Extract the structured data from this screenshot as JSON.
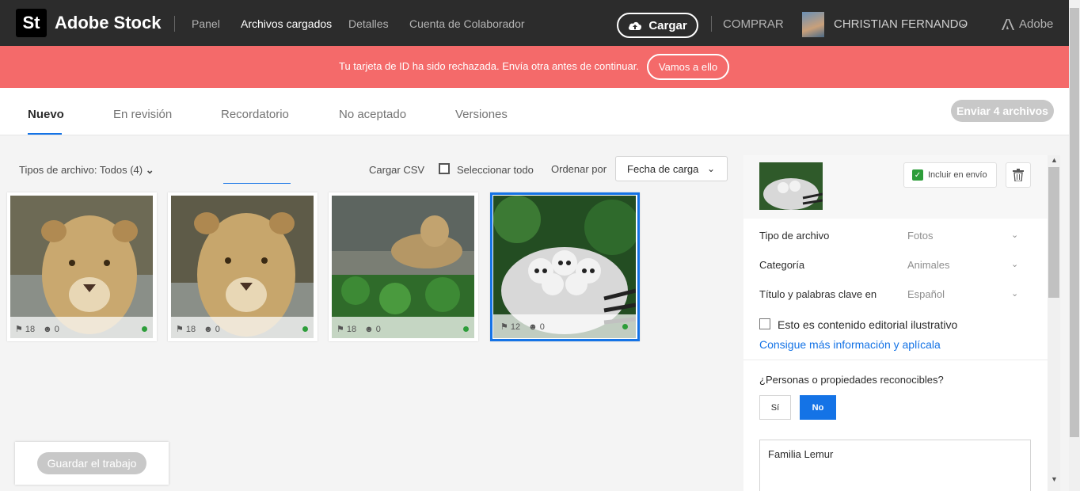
{
  "nav": {
    "logo": "St",
    "brand": "Adobe Stock",
    "items": [
      "Panel",
      "Archivos cargados",
      "Detalles",
      "Cuenta de Colaborador"
    ],
    "upload_label": "Cargar",
    "buy_label": "COMPRAR",
    "user_name": "CHRISTIAN FERNANDO",
    "adobe_label": "Adobe"
  },
  "banner": {
    "message": "Tu tarjeta de ID ha sido rechazada. Envía otra antes de continuar.",
    "button_label": "Vamos a ello",
    "color": "#f46a6a"
  },
  "tabs": [
    "Nuevo",
    "En revisión",
    "Recordatorio",
    "No aceptado",
    "Versiones"
  ],
  "send_label": "Enviar 4 archivos",
  "toolbar": {
    "filter_label": "Tipos de archivo: Todos (4)",
    "csv_label": "Cargar CSV",
    "select_all_label": "Seleccionar todo",
    "sort_label": "Ordenar por",
    "sort_value": "Fecha de carga"
  },
  "thumbnails": [
    {
      "keywords": "18",
      "people": "0"
    },
    {
      "keywords": "18",
      "people": "0"
    },
    {
      "keywords": "18",
      "people": "0"
    },
    {
      "keywords": "12",
      "people": "0"
    }
  ],
  "save_label": "Guardar el trabajo",
  "panel": {
    "include_label": "Incluir en envío",
    "rows": [
      {
        "label": "Tipo de archivo",
        "value": "Fotos"
      },
      {
        "label": "Categoría",
        "value": "Animales"
      },
      {
        "label": "Título y palabras clave en",
        "value": "Español"
      }
    ],
    "editorial_label": "Esto es contenido editorial ilustrativo",
    "info_link": "Consigue más información y aplícala",
    "persons_label": "¿Personas o propiedades reconocibles?",
    "yes_label": "Sí",
    "no_label": "No",
    "title_value": "Familia Lemur"
  },
  "colors": {
    "accent": "#1473e6",
    "status_ok": "#2d9d3a"
  }
}
